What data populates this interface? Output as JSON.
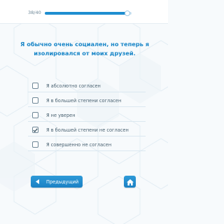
{
  "progress": {
    "label": "38/40",
    "fraction": 0.95
  },
  "question": {
    "text": "Я обычно очень социален, но теперь я изолировался от моих друзей."
  },
  "options": [
    {
      "label": "Я абсолютно согласен",
      "checked": false
    },
    {
      "label": "Я в большей степени согласен",
      "checked": false
    },
    {
      "label": "Я не уверен",
      "checked": false
    },
    {
      "label": "Я в большей степени не согласен",
      "checked": true
    },
    {
      "label": "Я совершенно не согласен",
      "checked": false
    }
  ],
  "navigation": {
    "previous_label": "Предыдущий",
    "previous_icon": "chevron-left-icon",
    "home_icon": "home-icon"
  },
  "colors": {
    "accent": "#1f8ed0",
    "question_text": "#1b87c8",
    "option_text": "#4a6271"
  }
}
